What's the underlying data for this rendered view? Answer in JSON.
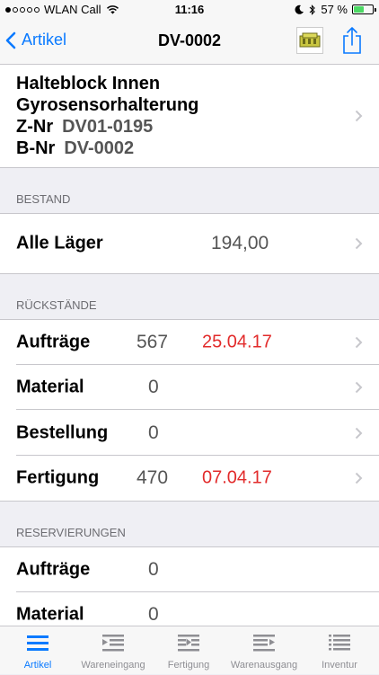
{
  "status_bar": {
    "carrier": "WLAN Call",
    "time": "11:16",
    "battery_percent": "57 %",
    "battery_level": 0.57,
    "signal_bars_filled": 1,
    "signal_bars_total": 5
  },
  "nav": {
    "back_label": "Artikel",
    "title": "DV-0002"
  },
  "article": {
    "name_line1": "Halteblock Innen",
    "name_line2": "Gyrosensorhalterung",
    "znr_label": "Z-Nr",
    "znr_value": "DV01-0195",
    "bnr_label": "B-Nr",
    "bnr_value": "DV-0002"
  },
  "bestand": {
    "header": "BESTAND",
    "rows": [
      {
        "label": "Alle Läger",
        "qty": "194,00"
      }
    ]
  },
  "rueckstaende": {
    "header": "RÜCKSTÄNDE",
    "rows": [
      {
        "label": "Aufträge",
        "qty": "567",
        "date": "25.04.17"
      },
      {
        "label": "Material",
        "qty": "0",
        "date": ""
      },
      {
        "label": "Bestellung",
        "qty": "0",
        "date": ""
      },
      {
        "label": "Fertigung",
        "qty": "470",
        "date": "07.04.17"
      }
    ]
  },
  "reservierungen": {
    "header": "RESERVIERUNGEN",
    "rows": [
      {
        "label": "Aufträge",
        "qty": "0"
      },
      {
        "label": "Material",
        "qty": "0"
      }
    ]
  },
  "tabs": [
    {
      "label": "Artikel",
      "icon": "list-icon",
      "active": true
    },
    {
      "label": "Wareneingang",
      "icon": "inbox-icon",
      "active": false
    },
    {
      "label": "Fertigung",
      "icon": "production-icon",
      "active": false
    },
    {
      "label": "Warenausgang",
      "icon": "outbox-icon",
      "active": false
    },
    {
      "label": "Inventur",
      "icon": "inventory-icon",
      "active": false
    }
  ],
  "colors": {
    "accent": "#0a7aff",
    "overdue": "#e22b2b",
    "background": "#efeff4"
  }
}
